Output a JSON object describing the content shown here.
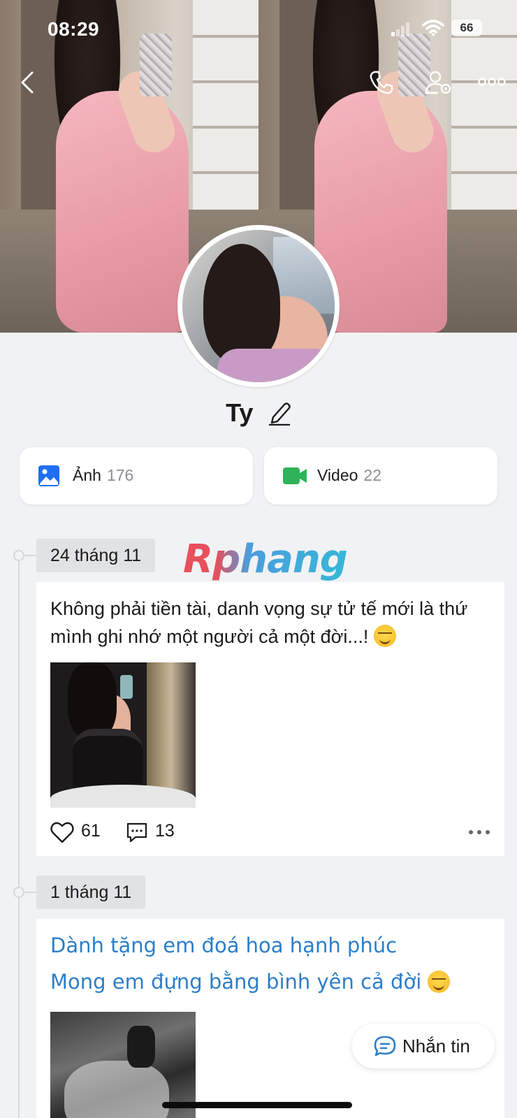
{
  "status": {
    "time": "08:29",
    "battery": "66"
  },
  "profile": {
    "name": "Ty"
  },
  "media": {
    "photos": {
      "label": "Ảnh",
      "count": "176"
    },
    "videos": {
      "label": "Video",
      "count": "22"
    }
  },
  "watermark": "Rphang",
  "posts": [
    {
      "date": "24 tháng 11",
      "text": "Không phải tiền tài,  danh vọng sự tử tế mới là thứ mình ghi nhớ một người cả một đời...! ",
      "likes": "61",
      "comments": "13"
    },
    {
      "date": "1 tháng 11",
      "lines": [
        "Dành tặng em đoá hoa hạnh phúc",
        "Mong em đựng bằng bình yên cả đời "
      ]
    }
  ],
  "message_button": {
    "label": "Nhắn tin"
  },
  "colors": {
    "accent_blue": "#2c7ec9",
    "photo_icon": "#1e6ff1",
    "video_icon": "#2fb35a"
  }
}
